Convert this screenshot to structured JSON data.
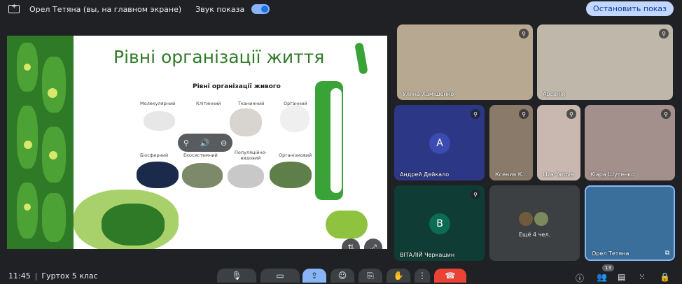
{
  "topbar": {
    "presenter_name": "Орел Тетяна (вы, на главном экране)",
    "sound_label": "Звук показа",
    "stop_button": "Остановить показ"
  },
  "slide": {
    "title": "Рівні організації життя",
    "subtitle": "Рівні організації живого",
    "levels_top": [
      "Молекулярний",
      "Клітинний",
      "Тканинний",
      "Органний"
    ],
    "levels_bottom": [
      "Біосферний",
      "Екосистемний",
      "Популяційно-видовий",
      "Організмовий"
    ]
  },
  "participants": [
    {
      "name": "Уляна Хамішенко",
      "avatar": ""
    },
    {
      "name": "Арсенія",
      "avatar": ""
    },
    {
      "name": "Андрей Дейкало",
      "avatar": "A",
      "color": "#3c4bb0"
    },
    {
      "name": "Ксения К...",
      "avatar": ""
    },
    {
      "name": "Liza Yarova",
      "avatar": ""
    },
    {
      "name": "Кіара Шутенко",
      "avatar": ""
    },
    {
      "name": "ВІТАЛІЙ Черкашин",
      "avatar": "B",
      "color": "#0b6b55"
    },
    {
      "name": "Ещё 4 чел.",
      "avatar": ""
    },
    {
      "name": "Орел Тетяна",
      "avatar": ""
    }
  ],
  "bottombar": {
    "time": "11:45",
    "meeting_name": "Гуртох 5 клас",
    "participants_count": "13"
  },
  "colors": {
    "accent": "#8ab4f8",
    "end_call": "#ea4335",
    "present_active": "#8ab4f8"
  }
}
